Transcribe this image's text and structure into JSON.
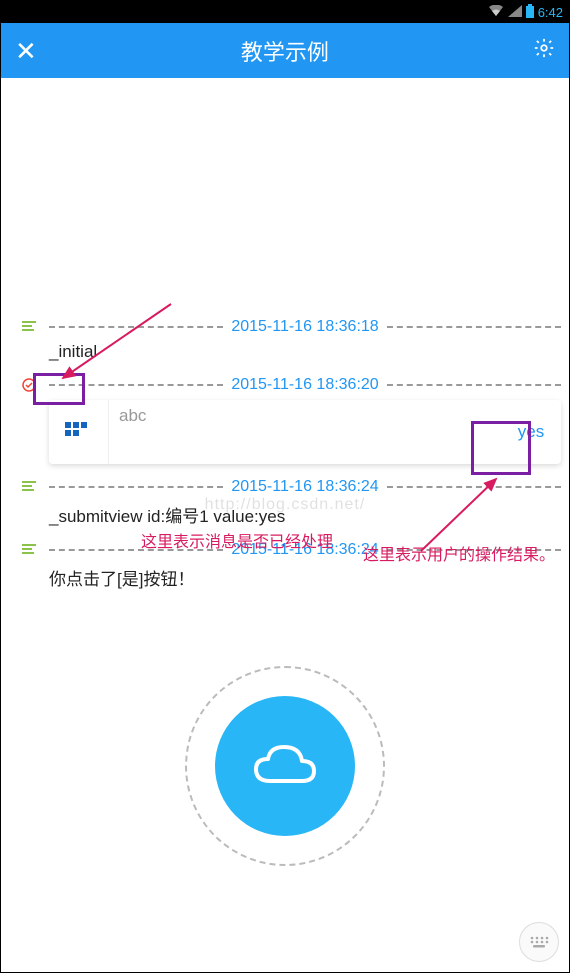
{
  "statusbar": {
    "time": "6:42"
  },
  "header": {
    "title": "教学示例"
  },
  "annotations": {
    "handled_note": "这里表示消息是否已经处理",
    "result_note": "这里表示用户的操作结果。"
  },
  "log": [
    {
      "icon": "list",
      "time": "2015-11-16 18:36:18",
      "text": "_initial"
    },
    {
      "icon": "check",
      "time": "2015-11-16 18:36:20",
      "card": {
        "label": "abc",
        "action": "yes"
      }
    },
    {
      "icon": "list",
      "time": "2015-11-16 18:36:24",
      "text": "_submitview id:编号1  value:yes"
    },
    {
      "icon": "list",
      "time": "2015-11-16 18:36:24",
      "text": "你点击了[是]按钮！"
    }
  ],
  "watermark": "http://blog.csdn.net/"
}
